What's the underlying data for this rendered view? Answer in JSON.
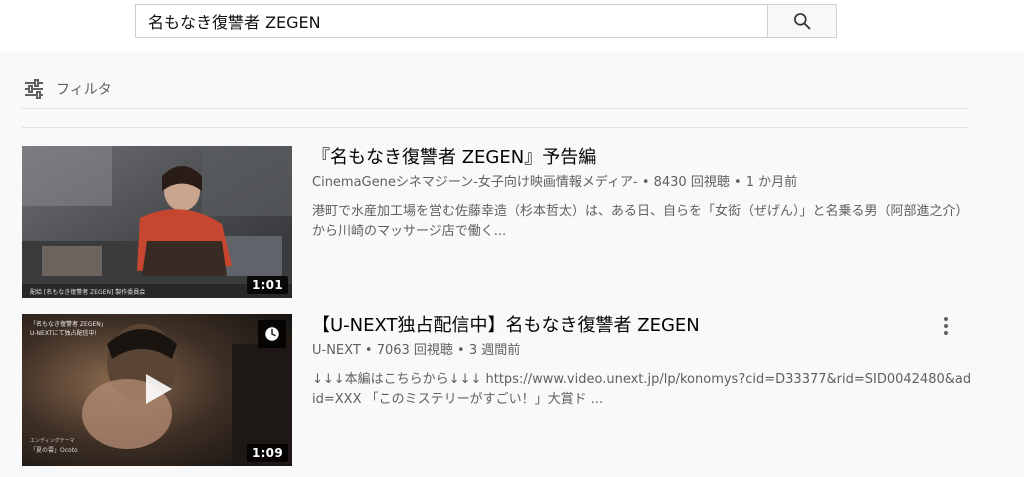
{
  "search": {
    "query": "名もなき復讐者 ZEGEN"
  },
  "filter": {
    "label": "フィルタ"
  },
  "videos": [
    {
      "title": "『名もなき復讐者 ZEGEN』予告編",
      "meta": "CinemaGeneシネマジーン-女子向け映画情報メディア- • 8430 回視聴 • 1 か月前",
      "description": "港町で水産加工場を営む佐藤幸造（杉本哲太）は、ある日、自らを「女衒（ぜげん）」と名乗る男（阿部進之介）から川崎のマッサージ店で働く...",
      "duration": "1:01",
      "thumb_caption": "配給 [名もなき復讐者 ZEGEN] 製作委員会"
    },
    {
      "title": "【U-NEXT独占配信中】名もなき復讐者 ZEGEN",
      "meta": "U-NEXT • 7063 回視聴 • 3 週間前",
      "description": "↓↓↓本編はこちらから↓↓↓ https://www.video.unext.jp/lp/konomys?cid=D33377&rid=SID0042480&adid=XXX 「このミステリーがすごい！」大賞ド ...",
      "duration": "1:09",
      "thumb_text_1": "「名もなき復讐者 ZEGEN」",
      "thumb_text_2": "U-NEXTにて独占配信中!",
      "thumb_text_3": "エンディングテーマ",
      "thumb_text_4": "「夏の雲」Ocoto"
    }
  ],
  "colors": {
    "background": "#f9f9f9",
    "title": "#030303",
    "secondary_text": "#606060"
  }
}
